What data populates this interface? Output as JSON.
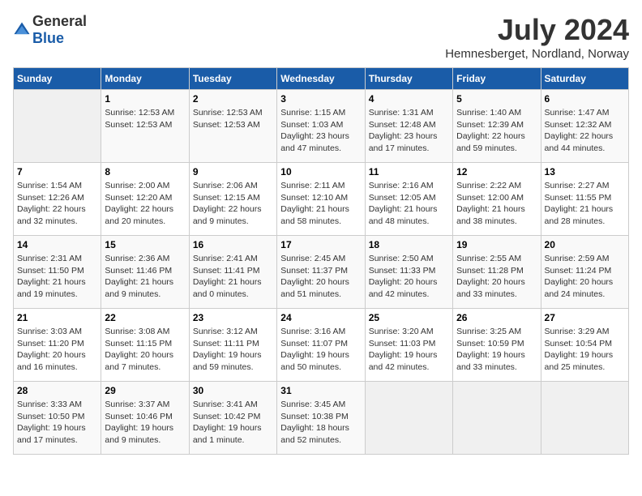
{
  "logo": {
    "general": "General",
    "blue": "Blue"
  },
  "title": "July 2024",
  "location": "Hemnesberget, Nordland, Norway",
  "weekdays": [
    "Sunday",
    "Monday",
    "Tuesday",
    "Wednesday",
    "Thursday",
    "Friday",
    "Saturday"
  ],
  "weeks": [
    [
      {
        "day": "",
        "info": ""
      },
      {
        "day": "1",
        "info": "Sunrise: 12:53 AM\nSunset: 12:53 AM"
      },
      {
        "day": "2",
        "info": "Sunrise: 12:53 AM\nSunset: 12:53 AM"
      },
      {
        "day": "3",
        "info": "Sunrise: 1:15 AM\nSunset: 1:03 AM\nDaylight: 23 hours and 47 minutes."
      },
      {
        "day": "4",
        "info": "Sunrise: 1:31 AM\nSunset: 12:48 AM\nDaylight: 23 hours and 17 minutes."
      },
      {
        "day": "5",
        "info": "Sunrise: 1:40 AM\nSunset: 12:39 AM\nDaylight: 22 hours and 59 minutes."
      },
      {
        "day": "6",
        "info": "Sunrise: 1:47 AM\nSunset: 12:32 AM\nDaylight: 22 hours and 44 minutes."
      }
    ],
    [
      {
        "day": "7",
        "info": "Sunrise: 1:54 AM\nSunset: 12:26 AM\nDaylight: 22 hours and 32 minutes."
      },
      {
        "day": "8",
        "info": "Sunrise: 2:00 AM\nSunset: 12:20 AM\nDaylight: 22 hours and 20 minutes."
      },
      {
        "day": "9",
        "info": "Sunrise: 2:06 AM\nSunset: 12:15 AM\nDaylight: 22 hours and 9 minutes."
      },
      {
        "day": "10",
        "info": "Sunrise: 2:11 AM\nSunset: 12:10 AM\nDaylight: 21 hours and 58 minutes."
      },
      {
        "day": "11",
        "info": "Sunrise: 2:16 AM\nSunset: 12:05 AM\nDaylight: 21 hours and 48 minutes."
      },
      {
        "day": "12",
        "info": "Sunrise: 2:22 AM\nSunset: 12:00 AM\nDaylight: 21 hours and 38 minutes."
      },
      {
        "day": "13",
        "info": "Sunrise: 2:27 AM\nSunset: 11:55 PM\nDaylight: 21 hours and 28 minutes."
      }
    ],
    [
      {
        "day": "14",
        "info": "Sunrise: 2:31 AM\nSunset: 11:50 PM\nDaylight: 21 hours and 19 minutes."
      },
      {
        "day": "15",
        "info": "Sunrise: 2:36 AM\nSunset: 11:46 PM\nDaylight: 21 hours and 9 minutes."
      },
      {
        "day": "16",
        "info": "Sunrise: 2:41 AM\nSunset: 11:41 PM\nDaylight: 21 hours and 0 minutes."
      },
      {
        "day": "17",
        "info": "Sunrise: 2:45 AM\nSunset: 11:37 PM\nDaylight: 20 hours and 51 minutes."
      },
      {
        "day": "18",
        "info": "Sunrise: 2:50 AM\nSunset: 11:33 PM\nDaylight: 20 hours and 42 minutes."
      },
      {
        "day": "19",
        "info": "Sunrise: 2:55 AM\nSunset: 11:28 PM\nDaylight: 20 hours and 33 minutes."
      },
      {
        "day": "20",
        "info": "Sunrise: 2:59 AM\nSunset: 11:24 PM\nDaylight: 20 hours and 24 minutes."
      }
    ],
    [
      {
        "day": "21",
        "info": "Sunrise: 3:03 AM\nSunset: 11:20 PM\nDaylight: 20 hours and 16 minutes."
      },
      {
        "day": "22",
        "info": "Sunrise: 3:08 AM\nSunset: 11:15 PM\nDaylight: 20 hours and 7 minutes."
      },
      {
        "day": "23",
        "info": "Sunrise: 3:12 AM\nSunset: 11:11 PM\nDaylight: 19 hours and 59 minutes."
      },
      {
        "day": "24",
        "info": "Sunrise: 3:16 AM\nSunset: 11:07 PM\nDaylight: 19 hours and 50 minutes."
      },
      {
        "day": "25",
        "info": "Sunrise: 3:20 AM\nSunset: 11:03 PM\nDaylight: 19 hours and 42 minutes."
      },
      {
        "day": "26",
        "info": "Sunrise: 3:25 AM\nSunset: 10:59 PM\nDaylight: 19 hours and 33 minutes."
      },
      {
        "day": "27",
        "info": "Sunrise: 3:29 AM\nSunset: 10:54 PM\nDaylight: 19 hours and 25 minutes."
      }
    ],
    [
      {
        "day": "28",
        "info": "Sunrise: 3:33 AM\nSunset: 10:50 PM\nDaylight: 19 hours and 17 minutes."
      },
      {
        "day": "29",
        "info": "Sunrise: 3:37 AM\nSunset: 10:46 PM\nDaylight: 19 hours and 9 minutes."
      },
      {
        "day": "30",
        "info": "Sunrise: 3:41 AM\nSunset: 10:42 PM\nDaylight: 19 hours and 1 minute."
      },
      {
        "day": "31",
        "info": "Sunrise: 3:45 AM\nSunset: 10:38 PM\nDaylight: 18 hours and 52 minutes."
      },
      {
        "day": "",
        "info": ""
      },
      {
        "day": "",
        "info": ""
      },
      {
        "day": "",
        "info": ""
      }
    ]
  ]
}
